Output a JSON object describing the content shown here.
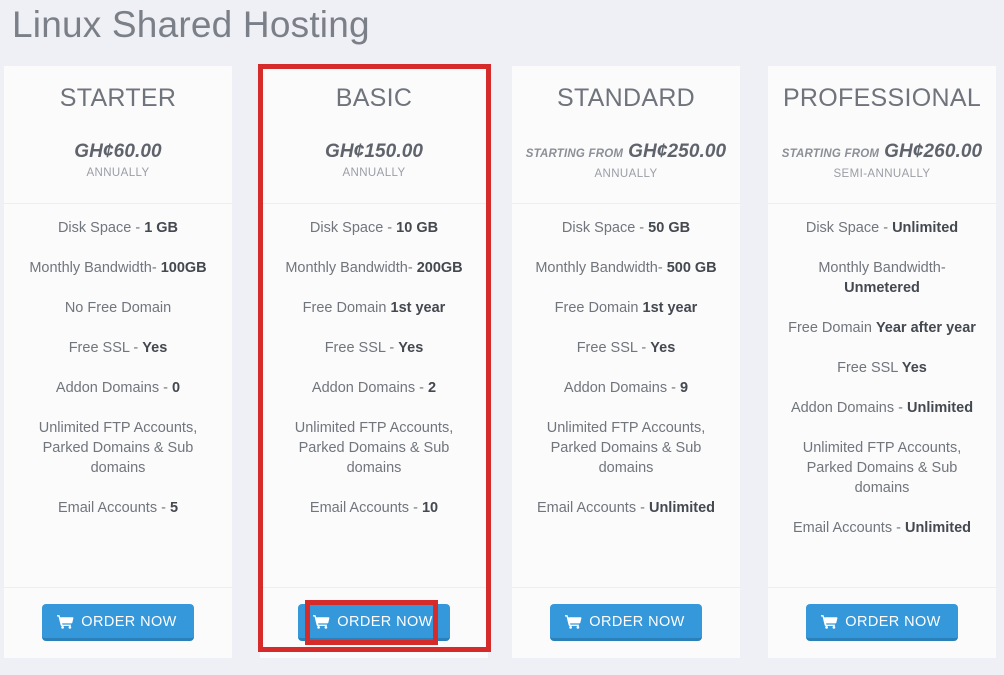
{
  "header": {
    "title": "Linux Shared Hosting"
  },
  "button": {
    "label": "ORDER NOW",
    "icon": "shopping-cart-icon",
    "glyph": "🛒",
    "color": "#3498db",
    "shadow_color": "#2a80b9"
  },
  "annotations": {
    "highlight_color": "#d52b2b",
    "targets": [
      "basic-plan-card",
      "basic-order-now-button"
    ]
  },
  "plans": [
    {
      "name": "STARTER",
      "price_prefix": "",
      "price": "GH¢60.00",
      "term": "ANNUALLY",
      "highlighted": false,
      "features": [
        {
          "label": "Disk Space - ",
          "value": "1 GB"
        },
        {
          "label": "Monthly Bandwidth- ",
          "value": "100GB"
        },
        {
          "label": "No Free Domain",
          "value": ""
        },
        {
          "label": "Free SSL - ",
          "value": "Yes"
        },
        {
          "label": "Addon Domains - ",
          "value": "0"
        },
        {
          "label": "Unlimited FTP Accounts, Parked Domains & Sub domains",
          "value": ""
        },
        {
          "label": "Email Accounts - ",
          "value": "5"
        }
      ]
    },
    {
      "name": "BASIC",
      "price_prefix": "",
      "price": "GH¢150.00",
      "term": "ANNUALLY",
      "highlighted": true,
      "features": [
        {
          "label": "Disk Space - ",
          "value": "10 GB"
        },
        {
          "label": "Monthly Bandwidth- ",
          "value": "200GB"
        },
        {
          "label": "Free Domain ",
          "value": "1st year"
        },
        {
          "label": "Free SSL - ",
          "value": "Yes"
        },
        {
          "label": "Addon Domains - ",
          "value": "2"
        },
        {
          "label": "Unlimited FTP Accounts, Parked Domains & Sub domains",
          "value": ""
        },
        {
          "label": "Email Accounts - ",
          "value": "10"
        }
      ]
    },
    {
      "name": "STANDARD",
      "price_prefix": "STARTING FROM",
      "price": "GH¢250.00",
      "term": "ANNUALLY",
      "highlighted": false,
      "features": [
        {
          "label": "Disk Space - ",
          "value": "50 GB"
        },
        {
          "label": "Monthly Bandwidth- ",
          "value": "500 GB"
        },
        {
          "label": "Free Domain ",
          "value": "1st year"
        },
        {
          "label": "Free SSL - ",
          "value": "Yes"
        },
        {
          "label": "Addon Domains - ",
          "value": "9"
        },
        {
          "label": "Unlimited FTP Accounts, Parked Domains & Sub domains",
          "value": ""
        },
        {
          "label": "Email Accounts - ",
          "value": "Unlimited"
        }
      ]
    },
    {
      "name": "PROFESSIONAL",
      "price_prefix": "STARTING FROM",
      "price": "GH¢260.00",
      "term": "SEMI-ANNUALLY",
      "highlighted": false,
      "features": [
        {
          "label": "Disk Space - ",
          "value": "Unlimited"
        },
        {
          "label": "Monthly Bandwidth- ",
          "value": "Unmetered"
        },
        {
          "label": "Free Domain ",
          "value": "Year after year"
        },
        {
          "label": "Free SSL ",
          "value": "Yes"
        },
        {
          "label": "Addon Domains - ",
          "value": "Unlimited"
        },
        {
          "label": "Unlimited FTP Accounts, Parked Domains & Sub domains",
          "value": ""
        },
        {
          "label": "Email Accounts - ",
          "value": "Unlimited"
        }
      ]
    }
  ]
}
